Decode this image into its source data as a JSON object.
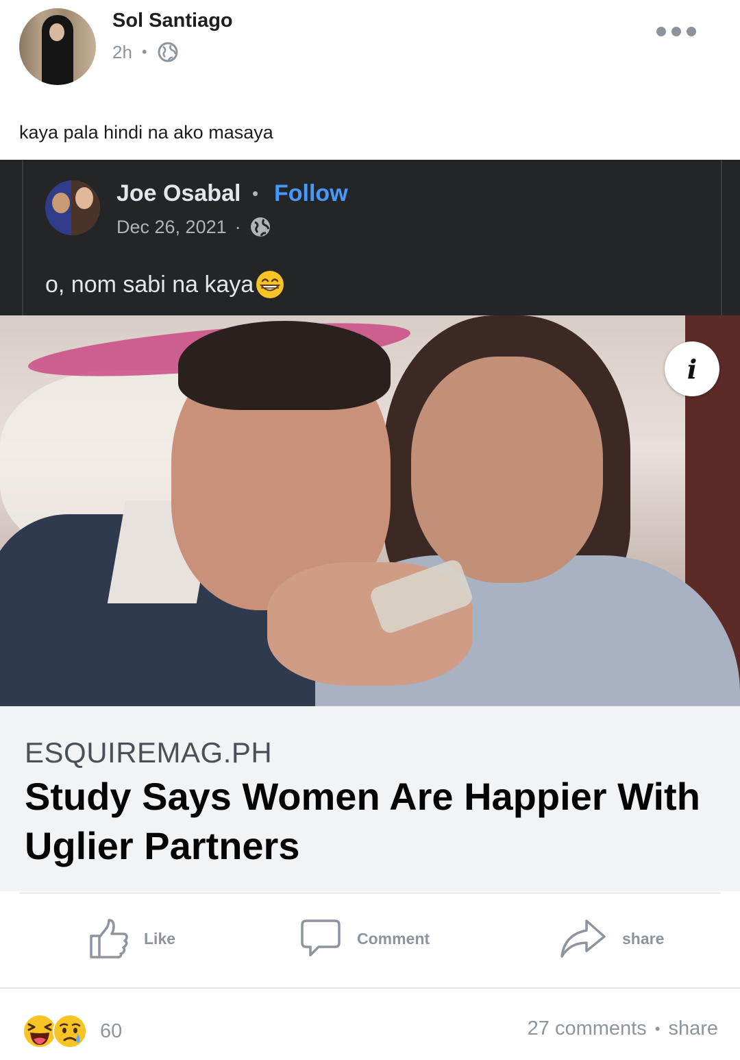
{
  "post": {
    "author_name": "Sol Santiago",
    "time_ago": "2h",
    "meta_separator": "•",
    "privacy_icon": "globe-icon",
    "more_icon": "more-options-icon",
    "text": "kaya pala hindi na ako masaya"
  },
  "shared_post": {
    "author_name": "Joe Osabal",
    "name_separator": "•",
    "follow_label": "Follow",
    "date": "Dec 26, 2021",
    "date_separator": "·",
    "privacy_icon": "globe-icon",
    "text": "o, nom sabi na kaya",
    "text_emoji": "grinning-face-emoji",
    "info_icon_label": "i",
    "link": {
      "domain": "ESQUIREMAG.PH",
      "title": "Study Says Women Are Happier With Uglier Partners"
    }
  },
  "actions": {
    "like_label": "Like",
    "comment_label": "Comment",
    "share_label": "share"
  },
  "footer": {
    "reaction_icons": [
      "laughing-face-icon",
      "sad-tear-face-icon"
    ],
    "reaction_count": "60",
    "comments_text": "27 comments",
    "separator": "•",
    "share_text": "share"
  },
  "colors": {
    "follow_blue": "#4599ff",
    "dark_card": "#242526",
    "muted_gray": "#8d949e",
    "link_preview_bg": "#f2f3f5"
  }
}
